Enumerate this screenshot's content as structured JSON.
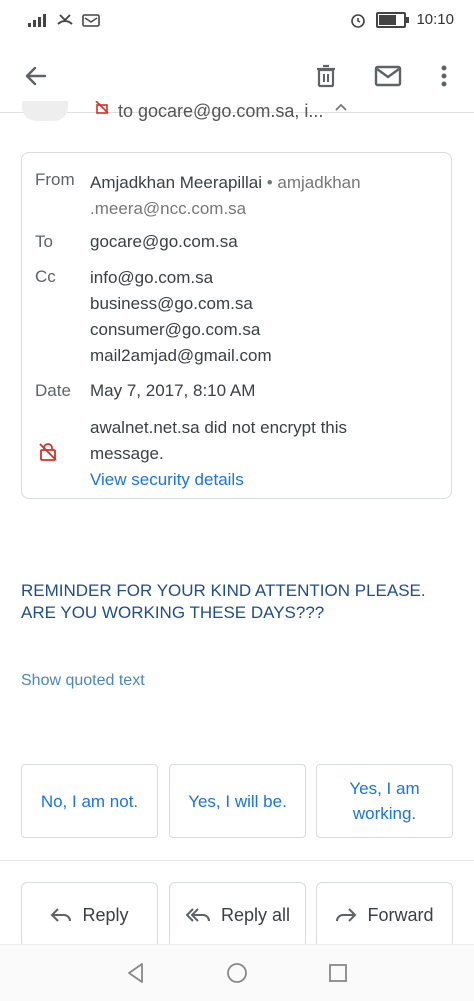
{
  "status_bar": {
    "time": "10:10",
    "battery_level": 0.7
  },
  "peek_row": {
    "text": "to gocare@go.com.sa, i..."
  },
  "details": {
    "from_label": "From",
    "from_name": "Amjadkhan Meerapillai",
    "from_separator": "•",
    "from_email_line1": "amjadkhan",
    "from_email_line2": ".meera@ncc.com.sa",
    "to_label": "To",
    "to_value": "gocare@go.com.sa",
    "cc_label": "Cc",
    "cc_values": [
      "info@go.com.sa",
      "business@go.com.sa",
      "consumer@go.com.sa",
      "mail2amjad@gmail.com"
    ],
    "date_label": "Date",
    "date_value": "May 7, 2017, 8:10 AM",
    "security_line1": "awalnet.net.sa did not encrypt this",
    "security_line2": "message.",
    "security_link": "View security details"
  },
  "message": {
    "line1": "REMINDER FOR YOUR KIND ATTENTION PLEASE.",
    "line2": "ARE YOU WORKING THESE DAYS???",
    "show_quoted": "Show quoted text"
  },
  "smart_replies": [
    {
      "line1": "No, I am not.",
      "line2": ""
    },
    {
      "line1": "Yes, I will be.",
      "line2": ""
    },
    {
      "line1": "Yes, I am",
      "line2": "working."
    }
  ],
  "actions": {
    "reply": "Reply",
    "reply_all": "Reply all",
    "forward": "Forward"
  },
  "colors": {
    "link": "#1a73e8",
    "body_text": "#1f4e8c",
    "warning_red": "#d93025"
  }
}
